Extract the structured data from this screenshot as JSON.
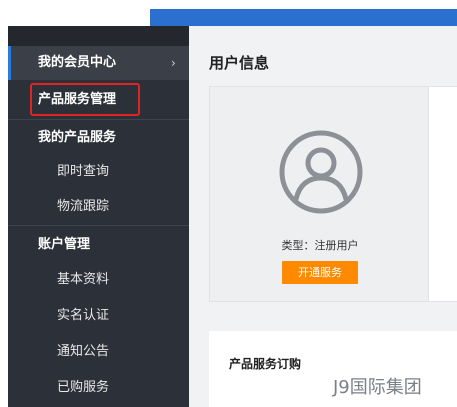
{
  "sidebar": {
    "member_center": "我的会员中心",
    "member_center_chevron": "›",
    "product_service_mgmt": "产品服务管理",
    "my_product_services": "我的产品服务",
    "realtime_query": "即时查询",
    "logistics_tracking": "物流跟踪",
    "account_mgmt": "账户管理",
    "basic_info": "基本资料",
    "real_name_auth": "实名认证",
    "notices": "通知公告",
    "purchased_services": "已购服务"
  },
  "main": {
    "page_title": "用户信息",
    "type_label": "类型：注册用户",
    "open_service_button": "开通服务",
    "product_order_title": "产品服务订购"
  },
  "watermark": "J9国际集团",
  "colors": {
    "sidebar_bg": "#2c3038",
    "accent_blue": "#2b7bdb",
    "highlight_red": "#e02424",
    "button_orange": "#ff8a00"
  },
  "icons": {
    "avatar": "user-circle-icon",
    "chevron": "chevron-right-icon"
  }
}
